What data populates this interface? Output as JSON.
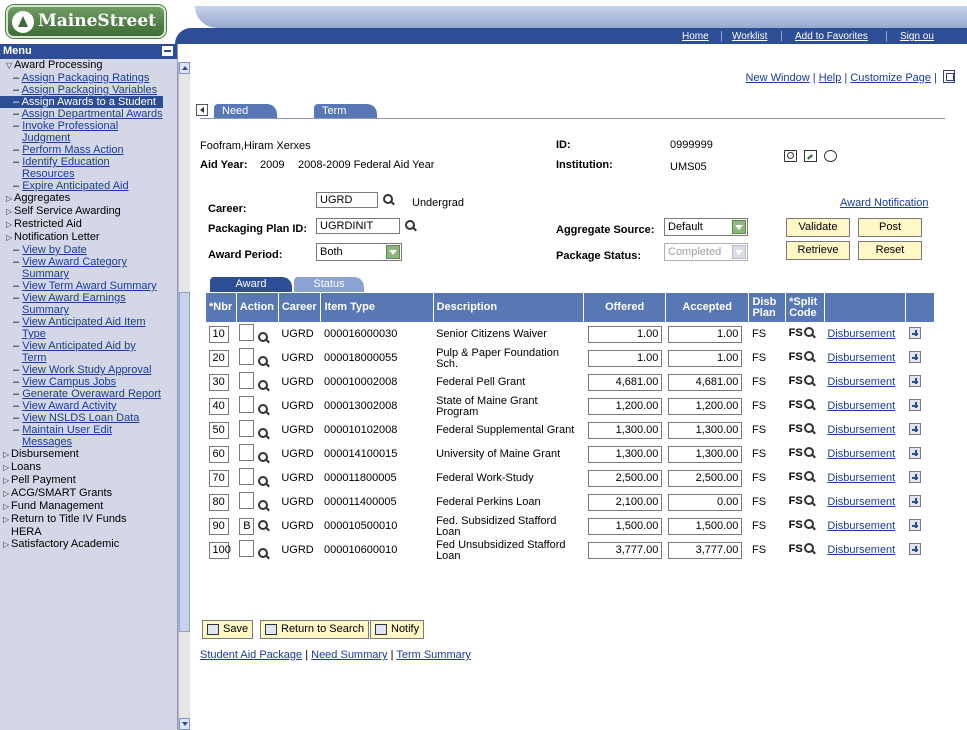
{
  "brand": {
    "logo_text": "MaineStreet"
  },
  "topnav": {
    "home": "Home",
    "worklist": "Worklist",
    "add_favorites": "Add to Favorites",
    "signout": "Sign ou"
  },
  "sidebar": {
    "menu_title": "Menu",
    "items": [
      {
        "label": "Award Processing",
        "type": "group-open"
      },
      {
        "label": "Assign Packaging Ratings",
        "type": "link"
      },
      {
        "label": "Assign Packaging Variables",
        "type": "link"
      },
      {
        "label": "Assign Awards to a Student",
        "type": "link-selected"
      },
      {
        "label": "Assign Departmental Awards",
        "type": "link"
      },
      {
        "label": "Invoke Professional Judgment",
        "type": "link"
      },
      {
        "label": "Perform Mass Action",
        "type": "link"
      },
      {
        "label": "Identify Education Resources",
        "type": "link"
      },
      {
        "label": "Expire Anticipated Aid",
        "type": "link"
      },
      {
        "label": "Aggregates",
        "type": "group"
      },
      {
        "label": "Self Service Awarding",
        "type": "group"
      },
      {
        "label": "Restricted Aid",
        "type": "group"
      },
      {
        "label": "Notification Letter",
        "type": "group"
      },
      {
        "label": "View by Date",
        "type": "link"
      },
      {
        "label": "View Award Category Summary",
        "type": "link"
      },
      {
        "label": "View Term Award Summary",
        "type": "link"
      },
      {
        "label": "View Award Earnings Summary",
        "type": "link"
      },
      {
        "label": "View Anticipated Aid Item Type",
        "type": "link"
      },
      {
        "label": "View Anticipated Aid by Term",
        "type": "link"
      },
      {
        "label": "View Work Study Approval",
        "type": "link"
      },
      {
        "label": "View Campus Jobs",
        "type": "link"
      },
      {
        "label": "Generate Overaward Report",
        "type": "link"
      },
      {
        "label": "View Award Activity",
        "type": "link"
      },
      {
        "label": "View NSLDS Loan Data",
        "type": "link"
      },
      {
        "label": "Maintain User Edit Messages",
        "type": "link"
      },
      {
        "label": "Disbursement",
        "type": "top"
      },
      {
        "label": "Loans",
        "type": "top"
      },
      {
        "label": "Pell Payment",
        "type": "top"
      },
      {
        "label": "ACG/SMART Grants",
        "type": "top"
      },
      {
        "label": "Fund Management",
        "type": "top"
      },
      {
        "label": "Return to Title IV Funds",
        "type": "top"
      },
      {
        "label": "HERA",
        "type": "plain"
      },
      {
        "label": "Satisfactory Academic",
        "type": "top"
      }
    ]
  },
  "header_links": {
    "new_window": "New Window",
    "help": "Help",
    "customize": "Customize Page"
  },
  "page_tabs": {
    "need_summary": "Need Summary",
    "term_summary": "Term Summary"
  },
  "student": {
    "name": "Foofram,Hiram Xerxes",
    "id_label": "ID:",
    "id": "0999999",
    "aid_year_label": "Aid Year:",
    "aid_year": "2009",
    "aid_year_desc": "2008-2009 Federal Aid Year",
    "institution_label": "Institution:",
    "institution": "UMS05"
  },
  "form": {
    "career_label": "Career:",
    "career": "UGRD",
    "career_desc": "Undergrad",
    "plan_label": "Packaging Plan ID:",
    "plan": "UGRDINIT",
    "period_label": "Award Period:",
    "period": "Both",
    "agg_label": "Aggregate Source:",
    "agg": "Default",
    "status_label": "Package Status:",
    "status": "Completed",
    "award_notification": "Award Notification",
    "validate": "Validate",
    "post": "Post",
    "retrieve": "Retrieve",
    "reset": "Reset"
  },
  "grid_tabs": {
    "award": "Award",
    "status": "Status"
  },
  "grid": {
    "headers": [
      "*Nbr",
      "Action",
      "Career",
      "Item Type",
      "Description",
      "Offered",
      "Accepted",
      "Disb Plan",
      "*Split Code",
      "",
      ""
    ],
    "rows": [
      {
        "nbr": "10",
        "action": "",
        "career": "UGRD",
        "item": "000016000030",
        "desc": "Senior Citizens Waiver",
        "offered": "1.00",
        "accepted": "1.00",
        "disb": "FS",
        "split": "FS",
        "link": "Disbursement"
      },
      {
        "nbr": "20",
        "action": "",
        "career": "UGRD",
        "item": "000018000055",
        "desc": "Pulp & Paper Foundation Sch.",
        "offered": "1.00",
        "accepted": "1.00",
        "disb": "FS",
        "split": "FS",
        "link": "Disbursement"
      },
      {
        "nbr": "30",
        "action": "",
        "career": "UGRD",
        "item": "000010002008",
        "desc": "Federal Pell Grant",
        "offered": "4,681.00",
        "accepted": "4,681.00",
        "disb": "FS",
        "split": "FS",
        "link": "Disbursement"
      },
      {
        "nbr": "40",
        "action": "",
        "career": "UGRD",
        "item": "000013002008",
        "desc": "State of Maine Grant Program",
        "offered": "1,200.00",
        "accepted": "1,200.00",
        "disb": "FS",
        "split": "FS",
        "link": "Disbursement"
      },
      {
        "nbr": "50",
        "action": "",
        "career": "UGRD",
        "item": "000010102008",
        "desc": "Federal Supplemental Grant",
        "offered": "1,300.00",
        "accepted": "1,300.00",
        "disb": "FS",
        "split": "FS",
        "link": "Disbursement"
      },
      {
        "nbr": "60",
        "action": "",
        "career": "UGRD",
        "item": "000014100015",
        "desc": "University of Maine Grant",
        "offered": "1,300.00",
        "accepted": "1,300.00",
        "disb": "FS",
        "split": "FS",
        "link": "Disbursement"
      },
      {
        "nbr": "70",
        "action": "",
        "career": "UGRD",
        "item": "000011800005",
        "desc": "Federal Work-Study",
        "offered": "2,500.00",
        "accepted": "2,500.00",
        "disb": "FS",
        "split": "FS",
        "link": "Disbursement"
      },
      {
        "nbr": "80",
        "action": "",
        "career": "UGRD",
        "item": "000011400005",
        "desc": "Federal Perkins Loan",
        "offered": "2,100.00",
        "accepted": "0.00",
        "disb": "FS",
        "split": "FS",
        "link": "Disbursement"
      },
      {
        "nbr": "90",
        "action": "B",
        "career": "UGRD",
        "item": "000010500010",
        "desc": "Fed. Subsidized Stafford Loan",
        "offered": "1,500.00",
        "accepted": "1,500.00",
        "disb": "FS",
        "split": "FS",
        "link": "Disbursement"
      },
      {
        "nbr": "100",
        "action": "",
        "career": "UGRD",
        "item": "000010600010",
        "desc": "Fed Unsubsidized Stafford Loan",
        "offered": "3,777.00",
        "accepted": "3,777.00",
        "disb": "FS",
        "split": "FS",
        "link": "Disbursement"
      }
    ]
  },
  "toolbar": {
    "save": "Save",
    "return": "Return to Search",
    "notify": "Notify"
  },
  "footer": {
    "student_aid": "Student Aid Package",
    "need_summary": "Need Summary",
    "term_summary": "Term Summary"
  }
}
